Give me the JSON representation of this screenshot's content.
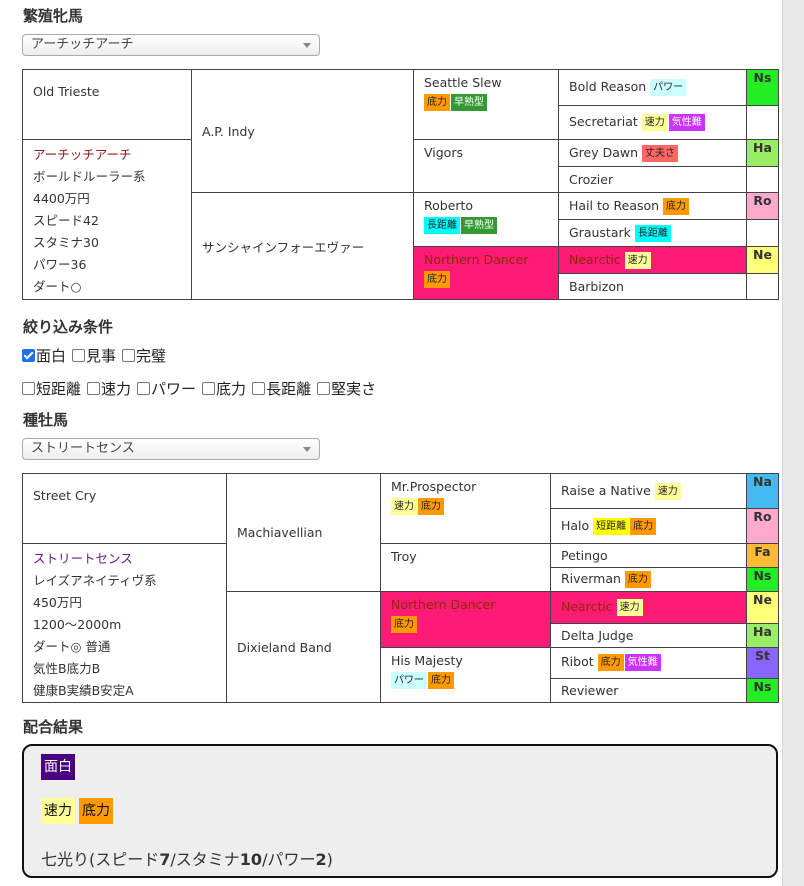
{
  "mare_section": {
    "heading": "繁殖牝馬",
    "selected": "アーチッチアーチ",
    "main": {
      "sire": "Old Trieste",
      "name": "アーチッチアーチ",
      "line": "ボールドルーラー系",
      "price": "4400万円",
      "speed": "スピード42",
      "stamina": "スタミナ30",
      "power": "パワー36",
      "dirt": "ダート○"
    },
    "gen1": [
      "A.P. Indy",
      "サンシャインフォーエヴァー"
    ],
    "gen2": [
      {
        "name": "Seattle Slew",
        "tags": [
          {
            "t": "底力",
            "c": "stam"
          },
          {
            "t": "早熟型",
            "c": "early"
          }
        ]
      },
      {
        "name": "Vigors",
        "tags": []
      },
      {
        "name": "Roberto",
        "tags": [
          {
            "t": "長距離",
            "c": "long"
          },
          {
            "t": "早熟型",
            "c": "early"
          }
        ]
      },
      {
        "name": "Northern Dancer",
        "tags": [
          {
            "t": "底力",
            "c": "stam"
          }
        ],
        "red": true
      }
    ],
    "gen3": [
      {
        "name": "Bold Reason",
        "tags": [
          {
            "t": "パワー",
            "c": "power"
          }
        ],
        "code": "Ns",
        "cc": "ns"
      },
      {
        "name": "Secretariat",
        "tags": [
          {
            "t": "速力",
            "c": "speed"
          },
          {
            "t": "気性難",
            "c": "temper"
          }
        ],
        "code": "",
        "cc": "empty"
      },
      {
        "name": "Grey Dawn",
        "tags": [
          {
            "t": "丈夫さ",
            "c": "tough"
          }
        ],
        "code": "Ha",
        "cc": "ha"
      },
      {
        "name": "Crozier",
        "tags": [],
        "code": "",
        "cc": "empty"
      },
      {
        "name": "Hail to Reason",
        "tags": [
          {
            "t": "底力",
            "c": "stam"
          }
        ],
        "code": "Ro",
        "cc": "ro"
      },
      {
        "name": "Graustark",
        "tags": [
          {
            "t": "長距離",
            "c": "long"
          }
        ],
        "code": "",
        "cc": "empty"
      },
      {
        "name": "Nearctic",
        "tags": [
          {
            "t": "速力",
            "c": "speed"
          }
        ],
        "code": "Ne",
        "cc": "ne",
        "red": true
      },
      {
        "name": "Barbizon",
        "tags": [],
        "code": "",
        "cc": "empty"
      }
    ]
  },
  "filter": {
    "heading": "絞り込み条件",
    "row1": [
      {
        "label": "面白",
        "checked": true
      },
      {
        "label": "見事",
        "checked": false
      },
      {
        "label": "完璧",
        "checked": false
      }
    ],
    "row2": [
      {
        "label": "短距離",
        "checked": false
      },
      {
        "label": "速力",
        "checked": false
      },
      {
        "label": "パワー",
        "checked": false
      },
      {
        "label": "底力",
        "checked": false
      },
      {
        "label": "長距離",
        "checked": false
      },
      {
        "label": "堅実さ",
        "checked": false
      }
    ]
  },
  "stallion_section": {
    "heading": "種牡馬",
    "selected": "ストリートセンス",
    "main": {
      "sire": "Street Cry",
      "name": "ストリートセンス",
      "line": "レイズアネイティヴ系",
      "price": "450万円",
      "distance": "1200〜2000m",
      "dirt": "ダート◎ 普通",
      "temper": "気性B底力B",
      "health": "健康B実績B安定A"
    },
    "gen1": [
      "Machiavellian",
      "Dixieland Band"
    ],
    "gen2": [
      {
        "name": "Mr.Prospector",
        "tags": [
          {
            "t": "速力",
            "c": "speed"
          },
          {
            "t": "底力",
            "c": "stam"
          }
        ]
      },
      {
        "name": "Troy",
        "tags": []
      },
      {
        "name": "Northern Dancer",
        "tags": [
          {
            "t": "底力",
            "c": "stam"
          }
        ],
        "red": true
      },
      {
        "name": "His Majesty",
        "tags": [
          {
            "t": "パワー",
            "c": "power"
          },
          {
            "t": "底力",
            "c": "stam"
          }
        ]
      }
    ],
    "gen3": [
      {
        "name": "Raise a Native",
        "tags": [
          {
            "t": "速力",
            "c": "speed"
          }
        ],
        "code": "Na",
        "cc": "na"
      },
      {
        "name": "Halo",
        "tags": [
          {
            "t": "短距離",
            "c": "short"
          },
          {
            "t": "底力",
            "c": "stam"
          }
        ],
        "code": "Ro",
        "cc": "ro"
      },
      {
        "name": "Petingo",
        "tags": [],
        "code": "Fa",
        "cc": "fa"
      },
      {
        "name": "Riverman",
        "tags": [
          {
            "t": "底力",
            "c": "stam"
          }
        ],
        "code": "Ns",
        "cc": "ns"
      },
      {
        "name": "Nearctic",
        "tags": [
          {
            "t": "速力",
            "c": "speed"
          }
        ],
        "code": "Ne",
        "cc": "ne",
        "red": true
      },
      {
        "name": "Delta Judge",
        "tags": [],
        "code": "Ha",
        "cc": "ha"
      },
      {
        "name": "Ribot",
        "tags": [
          {
            "t": "底力",
            "c": "stam"
          },
          {
            "t": "気性難",
            "c": "temper"
          }
        ],
        "code": "St",
        "cc": "st"
      },
      {
        "name": "Reviewer",
        "tags": [],
        "code": "Ns",
        "cc": "ns"
      }
    ]
  },
  "result": {
    "heading": "配合結果",
    "rank": "面白",
    "tags": [
      {
        "t": "速力",
        "c": "speed"
      },
      {
        "t": "底力",
        "c": "stam"
      }
    ],
    "summary_prefix": "七光り(スピード",
    "speed": "7",
    "sep1": "/スタミナ",
    "stamina": "10",
    "sep2": "/パワー",
    "power": "2",
    "suffix": ")"
  }
}
